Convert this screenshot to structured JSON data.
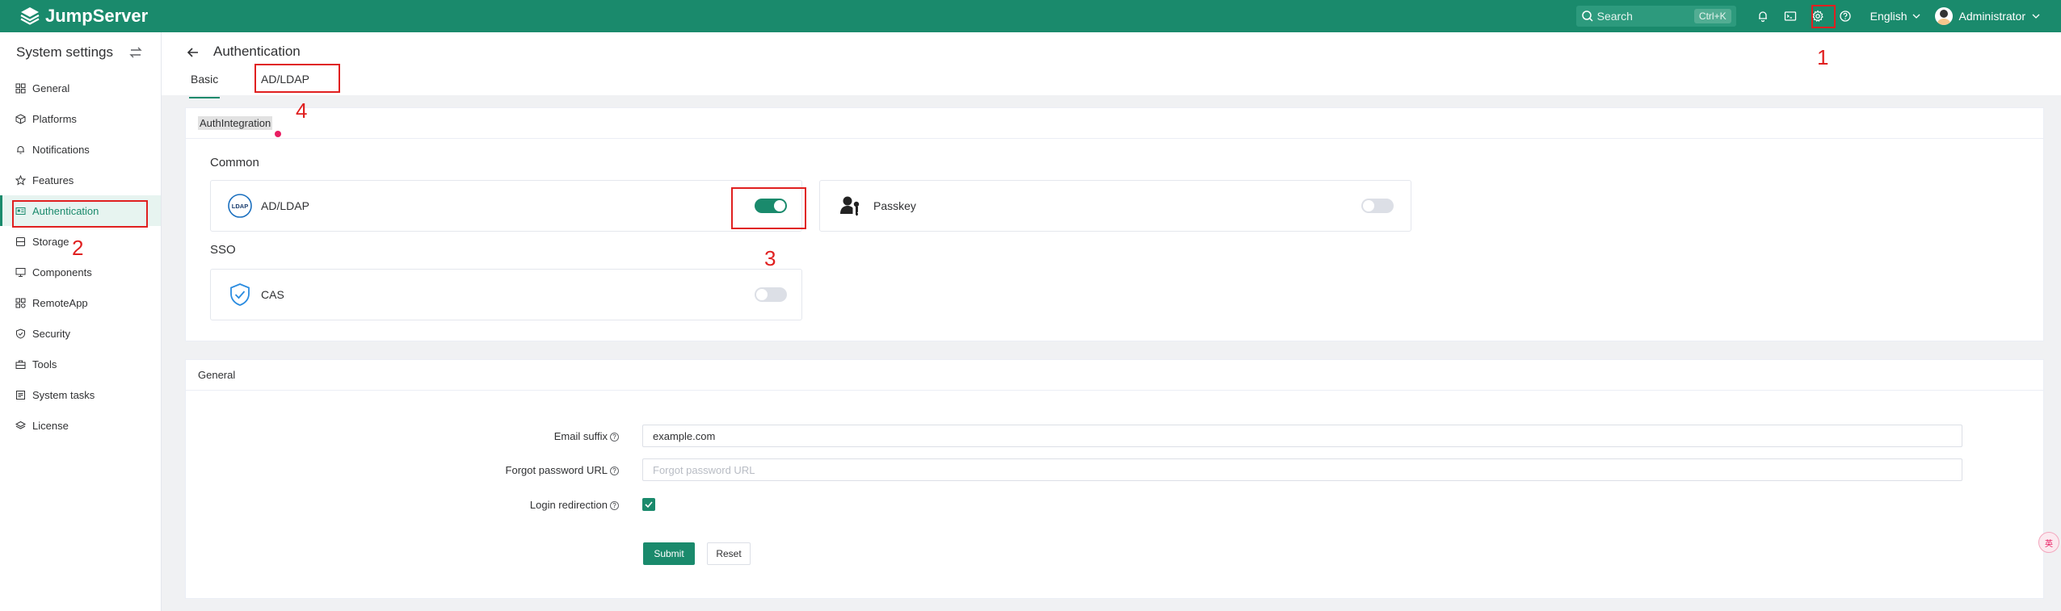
{
  "app": {
    "name": "JumpServer"
  },
  "topbar": {
    "search_placeholder": "Search",
    "search_shortcut": "Ctrl+K",
    "language": "English",
    "user": "Administrator"
  },
  "sidebar": {
    "title": "System settings",
    "items": [
      {
        "label": "General",
        "icon": "grid-icon"
      },
      {
        "label": "Platforms",
        "icon": "cube-icon"
      },
      {
        "label": "Notifications",
        "icon": "bell-icon"
      },
      {
        "label": "Features",
        "icon": "star-icon"
      },
      {
        "label": "Authentication",
        "icon": "id-card-icon",
        "active": true
      },
      {
        "label": "Storage",
        "icon": "database-icon"
      },
      {
        "label": "Components",
        "icon": "monitor-icon"
      },
      {
        "label": "RemoteApp",
        "icon": "apps-icon"
      },
      {
        "label": "Security",
        "icon": "shield-icon"
      },
      {
        "label": "Tools",
        "icon": "toolbox-icon"
      },
      {
        "label": "System tasks",
        "icon": "task-icon"
      },
      {
        "label": "License",
        "icon": "layers-icon"
      }
    ]
  },
  "header": {
    "title": "Authentication",
    "tabs": [
      {
        "label": "Basic",
        "active": true
      },
      {
        "label": "AD/LDAP",
        "active": false
      }
    ]
  },
  "auth_integration": {
    "title": "AuthIntegration",
    "common_label": "Common",
    "sso_label": "SSO",
    "ldap": {
      "name": "AD/LDAP",
      "logo_text": "LDAP",
      "enabled": true
    },
    "passkey": {
      "name": "Passkey",
      "enabled": false
    },
    "cas": {
      "name": "CAS",
      "enabled": false
    }
  },
  "general": {
    "title": "General",
    "email_suffix_label": "Email suffix",
    "email_suffix_value": "example.com",
    "forgot_password_label": "Forgot password URL",
    "forgot_password_placeholder": "Forgot password URL",
    "login_redirection_label": "Login redirection",
    "login_redirection_checked": true,
    "submit_label": "Submit",
    "reset_label": "Reset"
  },
  "annotations": {
    "step1": "1",
    "step2": "2",
    "step3": "3",
    "step4": "4"
  },
  "floating_button": {
    "text": "英"
  },
  "colors": {
    "brand": "#1a8a6c",
    "annotation": "#e02020"
  }
}
